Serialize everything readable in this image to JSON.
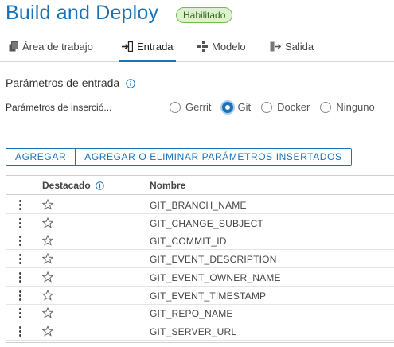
{
  "header": {
    "title": "Build and Deploy",
    "status": "Habilitado"
  },
  "tabs": [
    {
      "label": "Área de trabajo",
      "icon": "workspace-icon"
    },
    {
      "label": "Entrada",
      "icon": "input-icon",
      "active": true
    },
    {
      "label": "Modelo",
      "icon": "model-icon"
    },
    {
      "label": "Salida",
      "icon": "output-icon"
    }
  ],
  "section": {
    "title": "Parámetros de entrada",
    "param_label": "Parámetros de inserció...",
    "radio_options": [
      {
        "label": "Gerrit",
        "checked": false
      },
      {
        "label": "Git",
        "checked": true
      },
      {
        "label": "Docker",
        "checked": false
      },
      {
        "label": "Ninguno",
        "checked": false
      }
    ]
  },
  "buttons": {
    "add": "AGREGAR",
    "add_remove": "AGREGAR O ELIMINAR PARÁMETROS INSERTADOS"
  },
  "table": {
    "columns": [
      "Destacado",
      "Nombre"
    ],
    "rows": [
      "GIT_BRANCH_NAME",
      "GIT_CHANGE_SUBJECT",
      "GIT_COMMIT_ID",
      "GIT_EVENT_DESCRIPTION",
      "GIT_EVENT_OWNER_NAME",
      "GIT_EVENT_TIMESTAMP",
      "GIT_REPO_NAME",
      "GIT_SERVER_URL"
    ]
  },
  "colors": {
    "accent": "#1a73b8",
    "badge_bg": "#dff0d0",
    "badge_border": "#6dbf4b"
  }
}
